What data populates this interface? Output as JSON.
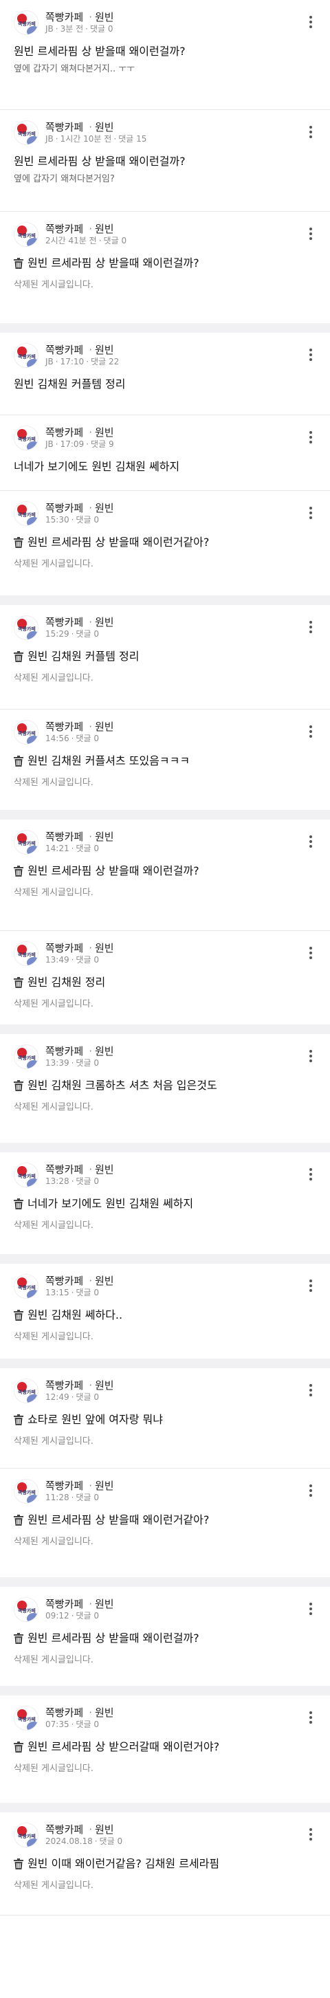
{
  "feed": {
    "posts": [
      {
        "cafe": "쪽빵카페",
        "board": "원빈",
        "author": "JB",
        "time": "3분 전",
        "comments_label": "댓글",
        "comments": "0",
        "title": "원빈 르세라핌 상 받을때 왜이런걸까?",
        "deleted": false,
        "preview": "옆에 갑자기 왜쳐다본거지.. ㅜㅜ"
      },
      {
        "cafe": "쪽빵카페",
        "board": "원빈",
        "author": "JB",
        "time": "1시간 10분 전",
        "comments_label": "댓글",
        "comments": "15",
        "title": "원빈 르세라핌 상 받을때 왜이런걸까?",
        "deleted": false,
        "preview": "옆에 갑자기 왜쳐다본거임?"
      },
      {
        "cafe": "쪽빵카페",
        "board": "원빈",
        "author": "",
        "time": "2시간 41분 전",
        "comments_label": "댓글",
        "comments": "0",
        "title": "원빈 르세라핌 상 받을때 왜이런걸까?",
        "deleted": true,
        "deleted_text": "삭제된 게시글입니다."
      },
      {
        "cafe": "쪽빵카페",
        "board": "원빈",
        "author": "JB",
        "time": "17:10",
        "comments_label": "댓글",
        "comments": "22",
        "title": "원빈 김채원 커플템 정리",
        "deleted": false,
        "preview": ""
      },
      {
        "cafe": "쪽빵카페",
        "board": "원빈",
        "author": "JB",
        "time": "17:09",
        "comments_label": "댓글",
        "comments": "9",
        "title": "너네가 보기에도 원빈 김채원 쎄하지",
        "deleted": false,
        "preview": ""
      },
      {
        "cafe": "쪽빵카페",
        "board": "원빈",
        "author": "",
        "time": "15:30",
        "comments_label": "댓글",
        "comments": "0",
        "title": "원빈 르세라핌 상 받을때 왜이런거같아?",
        "deleted": true,
        "deleted_text": "삭제된 게시글입니다."
      },
      {
        "cafe": "쪽빵카페",
        "board": "원빈",
        "author": "",
        "time": "15:29",
        "comments_label": "댓글",
        "comments": "0",
        "title": "원빈 김채원 커플템 정리",
        "deleted": true,
        "deleted_text": "삭제된 게시글입니다."
      },
      {
        "cafe": "쪽빵카페",
        "board": "원빈",
        "author": "",
        "time": "14:56",
        "comments_label": "댓글",
        "comments": "0",
        "title": "원빈 김채원 커플셔츠 또있음ㅋㅋㅋ",
        "deleted": true,
        "deleted_text": "삭제된 게시글입니다."
      },
      {
        "cafe": "쪽빵카페",
        "board": "원빈",
        "author": "",
        "time": "14:21",
        "comments_label": "댓글",
        "comments": "0",
        "title": "원빈 르세라핌 상 받을때 왜이런걸까?",
        "deleted": true,
        "deleted_text": "삭제된 게시글입니다."
      },
      {
        "cafe": "쪽빵카페",
        "board": "원빈",
        "author": "",
        "time": "13:49",
        "comments_label": "댓글",
        "comments": "0",
        "title": "원빈 김채원 정리",
        "deleted": true,
        "deleted_text": "삭제된 게시글입니다."
      },
      {
        "cafe": "쪽빵카페",
        "board": "원빈",
        "author": "",
        "time": "13:39",
        "comments_label": "댓글",
        "comments": "0",
        "title": "원빈 김채원 크롬하츠 셔츠 처음 입은것도",
        "deleted": true,
        "deleted_text": "삭제된 게시글입니다."
      },
      {
        "cafe": "쪽빵카페",
        "board": "원빈",
        "author": "",
        "time": "13:28",
        "comments_label": "댓글",
        "comments": "0",
        "title": "너네가 보기에도 원빈 김채원 쎄하지",
        "deleted": true,
        "deleted_text": "삭제된 게시글입니다."
      },
      {
        "cafe": "쪽빵카페",
        "board": "원빈",
        "author": "",
        "time": "13:15",
        "comments_label": "댓글",
        "comments": "0",
        "title": "원빈 김채원 쎄하다..",
        "deleted": true,
        "deleted_text": "삭제된 게시글입니다."
      },
      {
        "cafe": "쪽빵카페",
        "board": "원빈",
        "author": "",
        "time": "12:49",
        "comments_label": "댓글",
        "comments": "0",
        "title": "쇼타로 원빈 앞에 여자랑 뭐냐",
        "deleted": true,
        "deleted_text": "삭제된 게시글입니다."
      },
      {
        "cafe": "쪽빵카페",
        "board": "원빈",
        "author": "",
        "time": "11:28",
        "comments_label": "댓글",
        "comments": "0",
        "title": "원빈 르세라핌 상 받을때 왜이런거같아?",
        "deleted": true,
        "deleted_text": "삭제된 게시글입니다."
      },
      {
        "cafe": "쪽빵카페",
        "board": "원빈",
        "author": "",
        "time": "09:12",
        "comments_label": "댓글",
        "comments": "0",
        "title": "원빈 르세라핌 상 받을때 왜이런걸까?",
        "deleted": true,
        "deleted_text": "삭제된 게시글입니다."
      },
      {
        "cafe": "쪽빵카페",
        "board": "원빈",
        "author": "",
        "time": "07:35",
        "comments_label": "댓글",
        "comments": "0",
        "title": "원빈 르세라핌 상 받으러갈때 왜이런거야?",
        "deleted": true,
        "deleted_text": "삭제된 게시글입니다."
      },
      {
        "cafe": "쪽빵카페",
        "board": "원빈",
        "author": "",
        "time": "2024.08.18",
        "comments_label": "댓글",
        "comments": "0",
        "title": "원빈 이때 왜이런거같음? 김채원 르세라핌",
        "deleted": true,
        "deleted_text": "삭제된 게시글입니다."
      }
    ]
  },
  "icons": {
    "more": "more-vertical-icon",
    "trash": "trash-icon",
    "avatar": "cafe-avatar"
  },
  "colors": {
    "separator_band": "#f1f1f3",
    "meta_gray": "#8d8d8d",
    "avatar_red": "#d9232e",
    "avatar_blue": "#4a63b7"
  }
}
